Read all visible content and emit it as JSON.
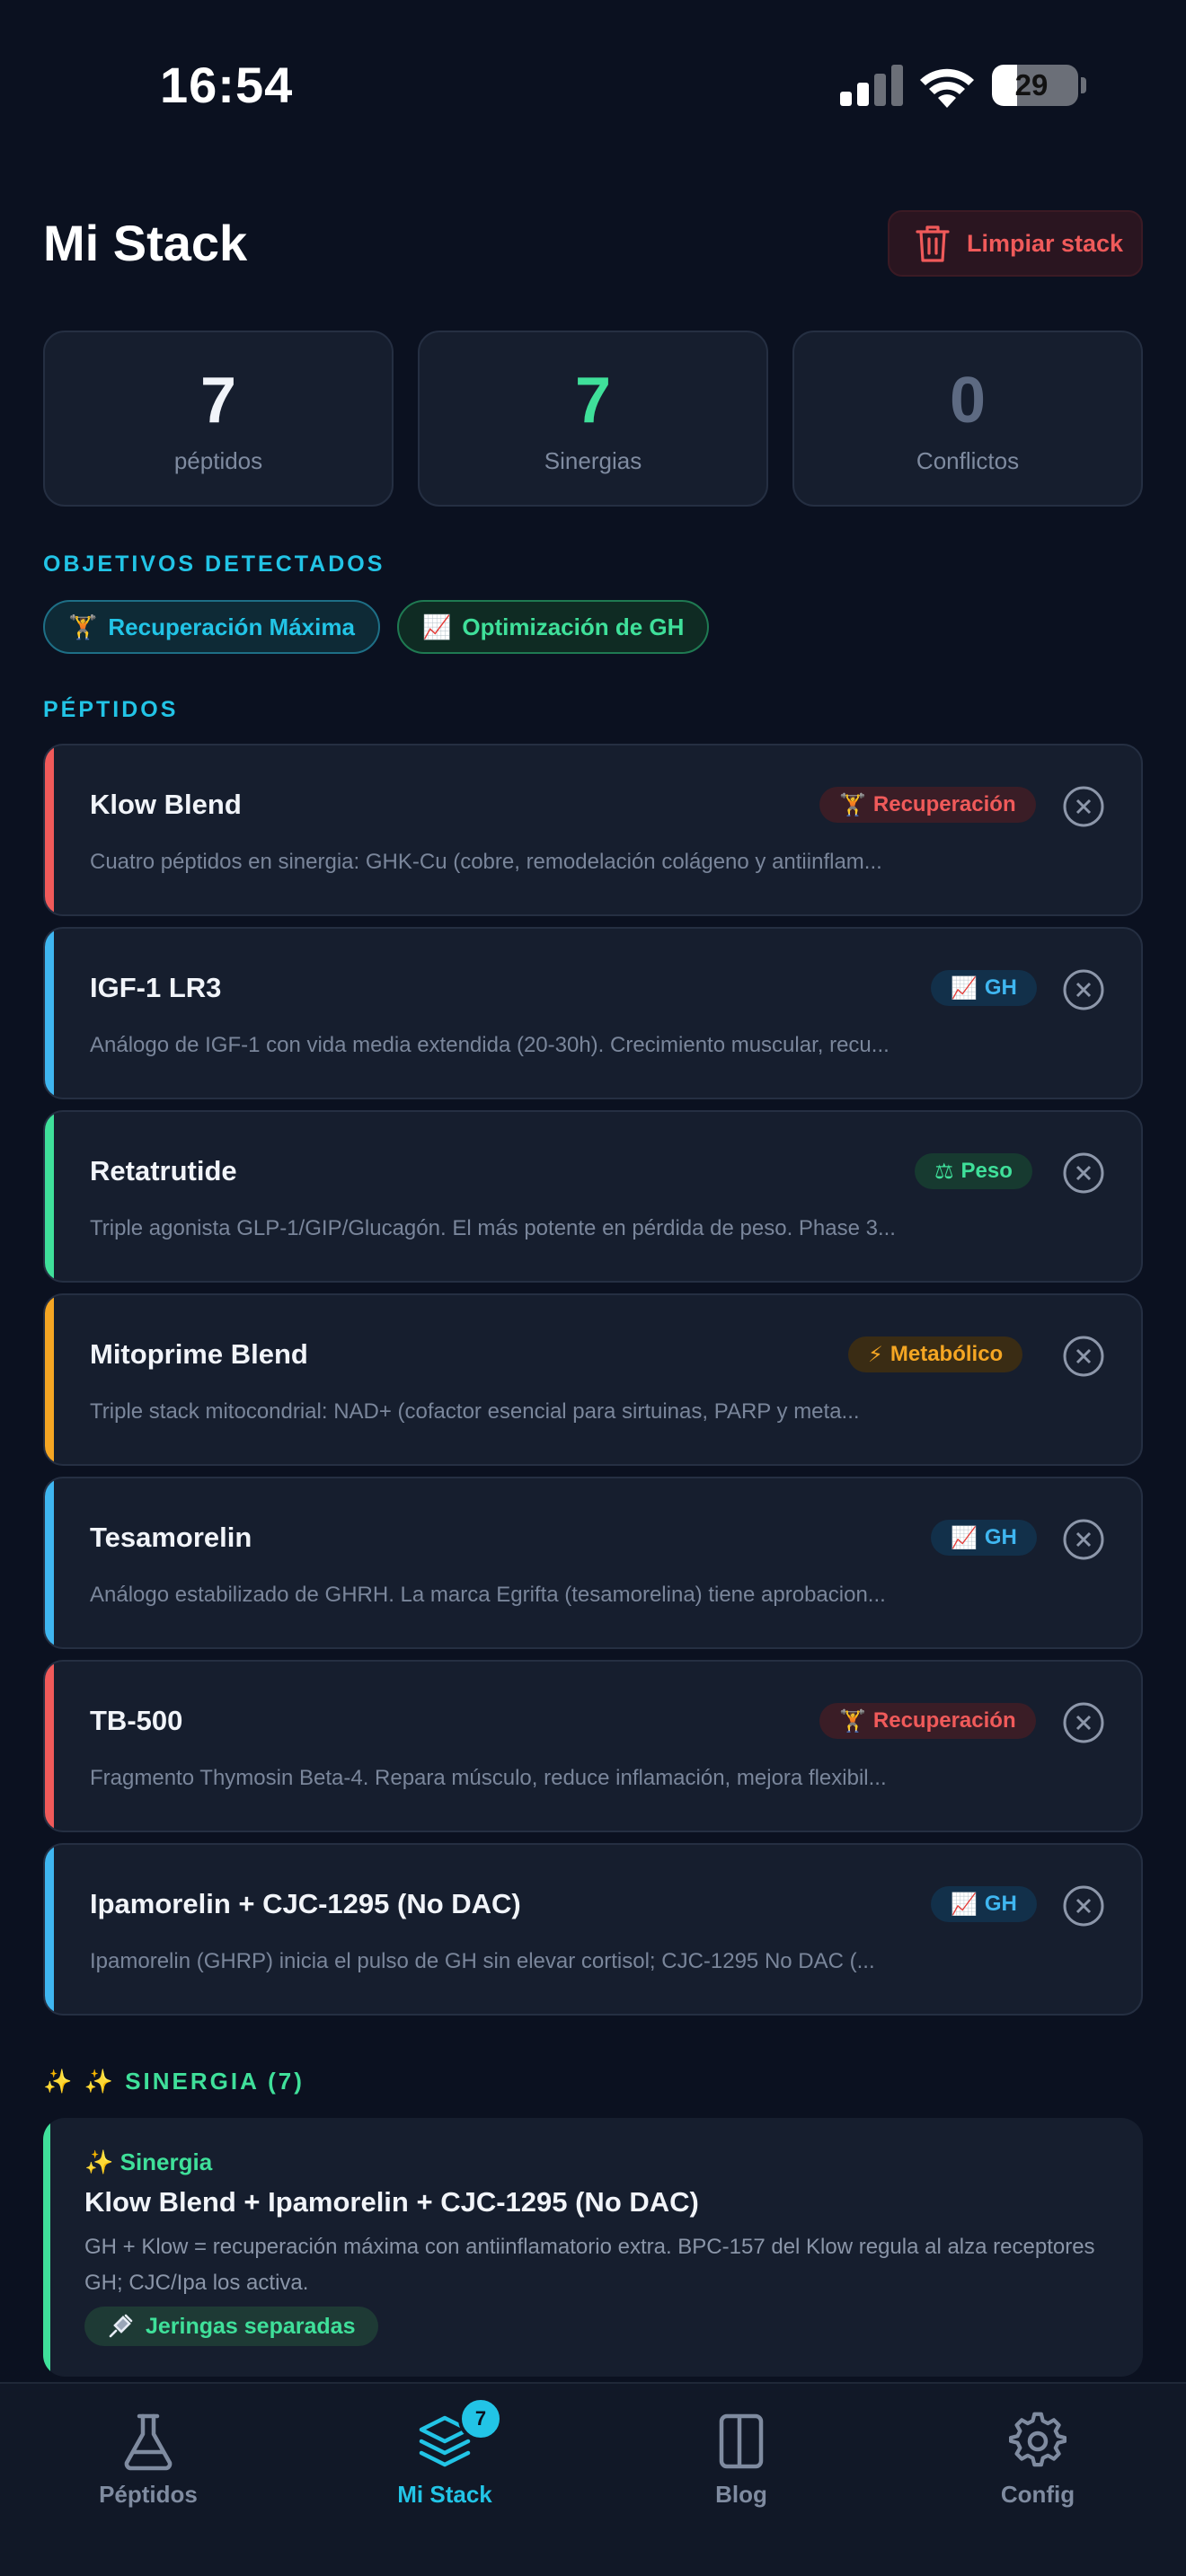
{
  "status_bar": {
    "time": "16:54",
    "battery": "29",
    "battery_level": 0.29
  },
  "header": {
    "title": "Mi Stack",
    "clear_label": "Limpiar stack"
  },
  "stats": [
    {
      "value": "7",
      "label": "péptidos",
      "color": "#f1f4f9"
    },
    {
      "value": "7",
      "label": "Sinergias",
      "color": "#3fe09a"
    },
    {
      "value": "0",
      "label": "Conflictos",
      "color": "#5d6a82"
    }
  ],
  "goals": {
    "heading": "OBJETIVOS DETECTADOS",
    "items": [
      {
        "emoji": "🏋",
        "label": "Recuperación Máxima",
        "color": "#22c4e6"
      },
      {
        "emoji": "📈",
        "label": "Optimización de GH",
        "color": "#3fe09a"
      }
    ]
  },
  "peptides": {
    "heading": "PÉPTIDOS",
    "items": [
      {
        "name": "Klow Blend",
        "badge_emoji": "🏋",
        "badge": "Recuperación",
        "accent": "#f05a5a",
        "desc": "Cuatro péptidos en sinergia: GHK-Cu (cobre, remodelación colágeno y antiinflam..."
      },
      {
        "name": "IGF-1 LR3",
        "badge_emoji": "📈",
        "badge": "GH",
        "accent": "#3fb6f0",
        "desc": "Análogo de IGF-1 con vida media extendida (20-30h). Crecimiento muscular, recu..."
      },
      {
        "name": "Retatrutide",
        "badge_emoji": "⚖",
        "badge": "Peso",
        "accent": "#3fe09a",
        "desc": "Triple agonista GLP-1/GIP/Glucagón. El más potente en pérdida de peso. Phase 3..."
      },
      {
        "name": "Mitoprime Blend",
        "badge_emoji": "⚡",
        "badge": "Metabólico",
        "accent": "#f5a623",
        "desc": "Triple stack mitocondrial: NAD+ (cofactor esencial para sirtuinas, PARP y meta..."
      },
      {
        "name": "Tesamorelin",
        "badge_emoji": "📈",
        "badge": "GH",
        "accent": "#3fb6f0",
        "desc": "Análogo estabilizado de GHRH. La marca Egrifta (tesamorelina) tiene aprobacion..."
      },
      {
        "name": "TB-500",
        "badge_emoji": "🏋",
        "badge": "Recuperación",
        "accent": "#f05a5a",
        "desc": "Fragmento Thymosin Beta-4. Repara músculo, reduce inflamación, mejora flexibil..."
      },
      {
        "name": "Ipamorelin + CJC-1295 (No DAC)",
        "badge_emoji": "📈",
        "badge": "GH",
        "accent": "#3fb6f0",
        "desc": "Ipamorelin (GHRP) inicia el pulso de GH sin elevar cortisol; CJC-1295 No DAC (..."
      }
    ]
  },
  "synergy": {
    "heading": "✨  ✨ SINERGIA (7)",
    "tag": "✨ Sinergia",
    "title": "Klow Blend + Ipamorelin + CJC-1295 (No DAC)",
    "desc": "GH + Klow = recuperación máxima con antiinflamatorio extra. BPC-157 del Klow regula al alza receptores GH; CJC/Ipa los activa.",
    "chip": "Jeringas separadas"
  },
  "nav": {
    "items": [
      {
        "label": "Péptidos",
        "active": false
      },
      {
        "label": "Mi Stack",
        "active": true,
        "badge": "7"
      },
      {
        "label": "Blog",
        "active": false
      },
      {
        "label": "Config",
        "active": false
      }
    ]
  },
  "colors": {
    "accent": "#22c4e6",
    "danger": "#f05a5a",
    "success": "#3fe09a",
    "inactive": "#7f8ba0"
  }
}
